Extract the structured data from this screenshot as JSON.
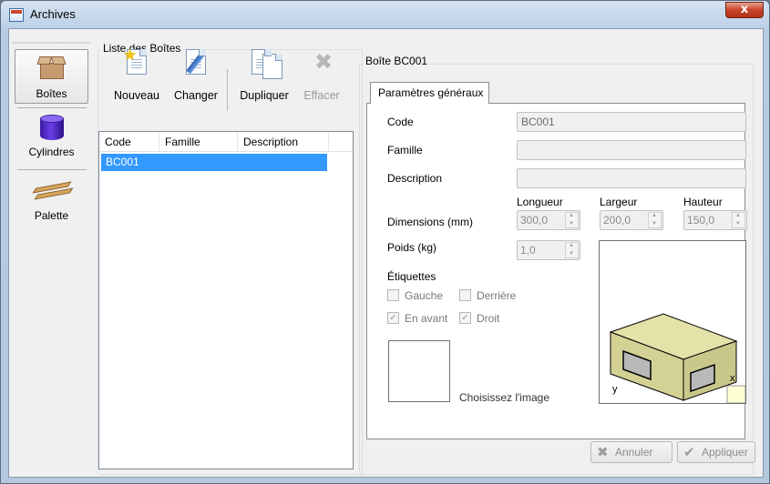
{
  "window": {
    "title": "Archives",
    "close_glyph": "x"
  },
  "nav": {
    "items": [
      {
        "label": "Boîtes",
        "icon": "box-icon",
        "active": true
      },
      {
        "label": "Cylindres",
        "icon": "cylinder-icon",
        "active": false
      },
      {
        "label": "Palette",
        "icon": "pallet-icon",
        "active": false
      }
    ]
  },
  "list_group": {
    "title": "Liste des Boîtes",
    "toolbar": {
      "new_label": "Nouveau",
      "edit_label": "Changer",
      "duplicate_label": "Dupliquer",
      "delete_label": "Effacer"
    },
    "columns": [
      "Code",
      "Famille",
      "Description"
    ],
    "rows": [
      {
        "code": "BC001",
        "famille": "",
        "description": ""
      }
    ]
  },
  "detail": {
    "title": "Boîte BC001",
    "tab_label": "Paramètres généraux",
    "code_label": "Code",
    "code_value": "BC001",
    "famille_label": "Famille",
    "famille_value": "",
    "description_label": "Description",
    "description_value": "",
    "dimensions_label": "Dimensions (mm)",
    "longueur_label": "Longueur",
    "longueur_value": "300,0",
    "largeur_label": "Largeur",
    "largeur_value": "200,0",
    "hauteur_label": "Hauteur",
    "hauteur_value": "150,0",
    "poids_label": "Poids (kg)",
    "poids_value": "1,0",
    "etiquettes_label": "Étiquettes",
    "chk_gauche": "Gauche",
    "chk_derriere": "Derrière",
    "chk_en_avant": "En avant",
    "chk_droit": "Droit",
    "choose_image": "Choisissez l'image",
    "axis_x": "x",
    "axis_y": "y"
  },
  "buttons": {
    "cancel": "Annuler",
    "apply": "Appliquer"
  },
  "colors": {
    "selection": "#3399ff",
    "box_face": "#e4e2a8",
    "box_side": "#c9c78a"
  }
}
